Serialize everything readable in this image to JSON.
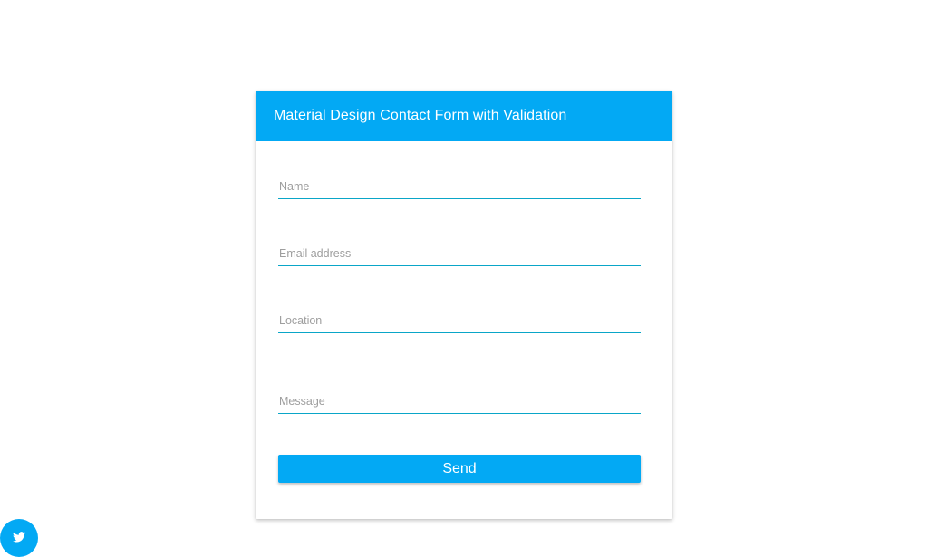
{
  "form": {
    "title": "Material Design Contact Form with Validation",
    "fields": [
      {
        "placeholder": "Name",
        "value": ""
      },
      {
        "placeholder": "Email address",
        "value": ""
      },
      {
        "placeholder": "Location",
        "value": ""
      },
      {
        "placeholder": "Message",
        "value": ""
      }
    ],
    "send_label": "Send"
  },
  "social": {
    "icon": "twitter-icon"
  },
  "colors": {
    "accent": "#03a9f4",
    "underline": "#0aa6c8"
  }
}
